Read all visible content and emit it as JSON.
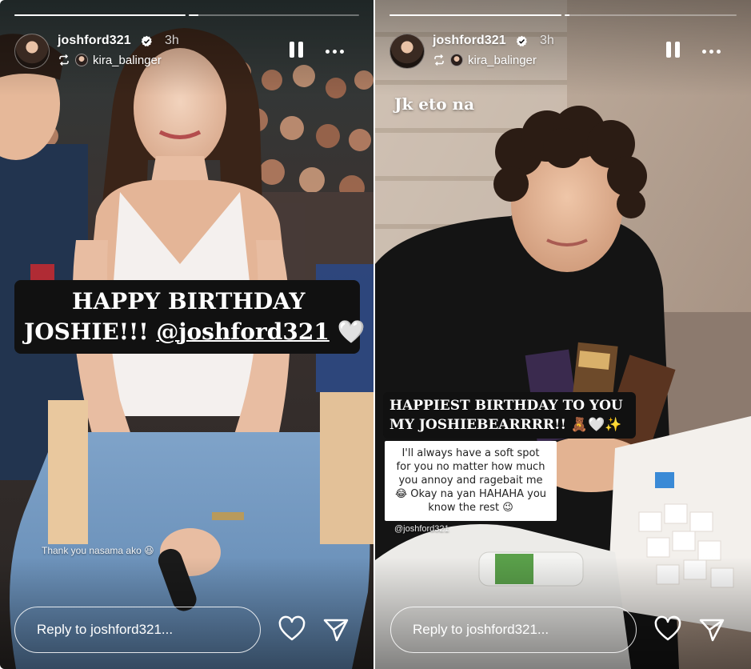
{
  "stories": [
    {
      "username": "joshford321",
      "time": "3h",
      "reposted_from": "kira_balinger",
      "progress": [
        1,
        0.2
      ],
      "reply_placeholder": "Reply to joshford321...",
      "sticker_lines": [
        "HAPPY BIRTHDAY",
        "JOSHIE!!! ",
        "@joshford321",
        " 🤍"
      ],
      "small_caption": "Thank you nasama ako 😆"
    },
    {
      "username": "joshford321",
      "time": "3h",
      "reposted_from": "kira_balinger",
      "progress": [
        1,
        0.05
      ],
      "reply_placeholder": "Reply to joshford321...",
      "top_caption": "Jk eto na",
      "sticker_lines": [
        "HAPPIEST BIRTHDAY TO YOU",
        "MY JOSHIEBEARRRR!! 🧸🤍✨"
      ],
      "note_lines": [
        "I'll always have a soft spot",
        "for you no matter how much",
        "you annoy and ragebait me",
        "😂 Okay na yan HAHAHA you",
        "know the rest 😉"
      ],
      "mention_tag": "@joshford321"
    }
  ],
  "colors": {
    "accent": "#ffffff",
    "sticker_bg": "#111111"
  }
}
